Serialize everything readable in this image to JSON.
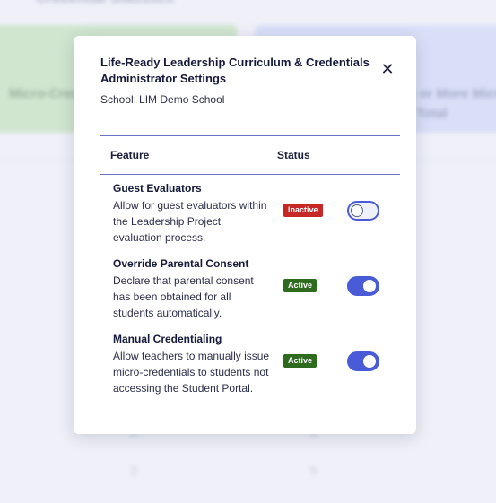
{
  "background": {
    "title": "Credential Statistics",
    "card_left_label": "Micro-Credentials",
    "card_right_label_1": "One or More Micro",
    "card_right_label_2": "Total",
    "numbers": [
      "0",
      "0",
      "2",
      "0"
    ]
  },
  "modal": {
    "title": "Life-Ready Leadership Curriculum & Credentials Administrator Settings",
    "close_icon": "close-icon",
    "school_label": "School:",
    "school_name": "LIM Demo School",
    "columns": {
      "feature": "Feature",
      "status": "Status"
    },
    "features": [
      {
        "name": "Guest Evaluators",
        "description": "Allow for guest evaluators within the Leadership Project evaluation process.",
        "status": "Inactive",
        "enabled": false
      },
      {
        "name": "Override Parental Consent",
        "description": "Declare that parental consent has been obtained for all students automatically.",
        "status": "Active",
        "enabled": true
      },
      {
        "name": "Manual Credentialing",
        "description": "Allow teachers to manually issue micro-credentials to students not accessing the Student Portal.",
        "status": "Active",
        "enabled": true
      }
    ]
  },
  "colors": {
    "accent": "#4a5bd8",
    "inactive": "#c62828",
    "active": "#2e6b1f"
  }
}
